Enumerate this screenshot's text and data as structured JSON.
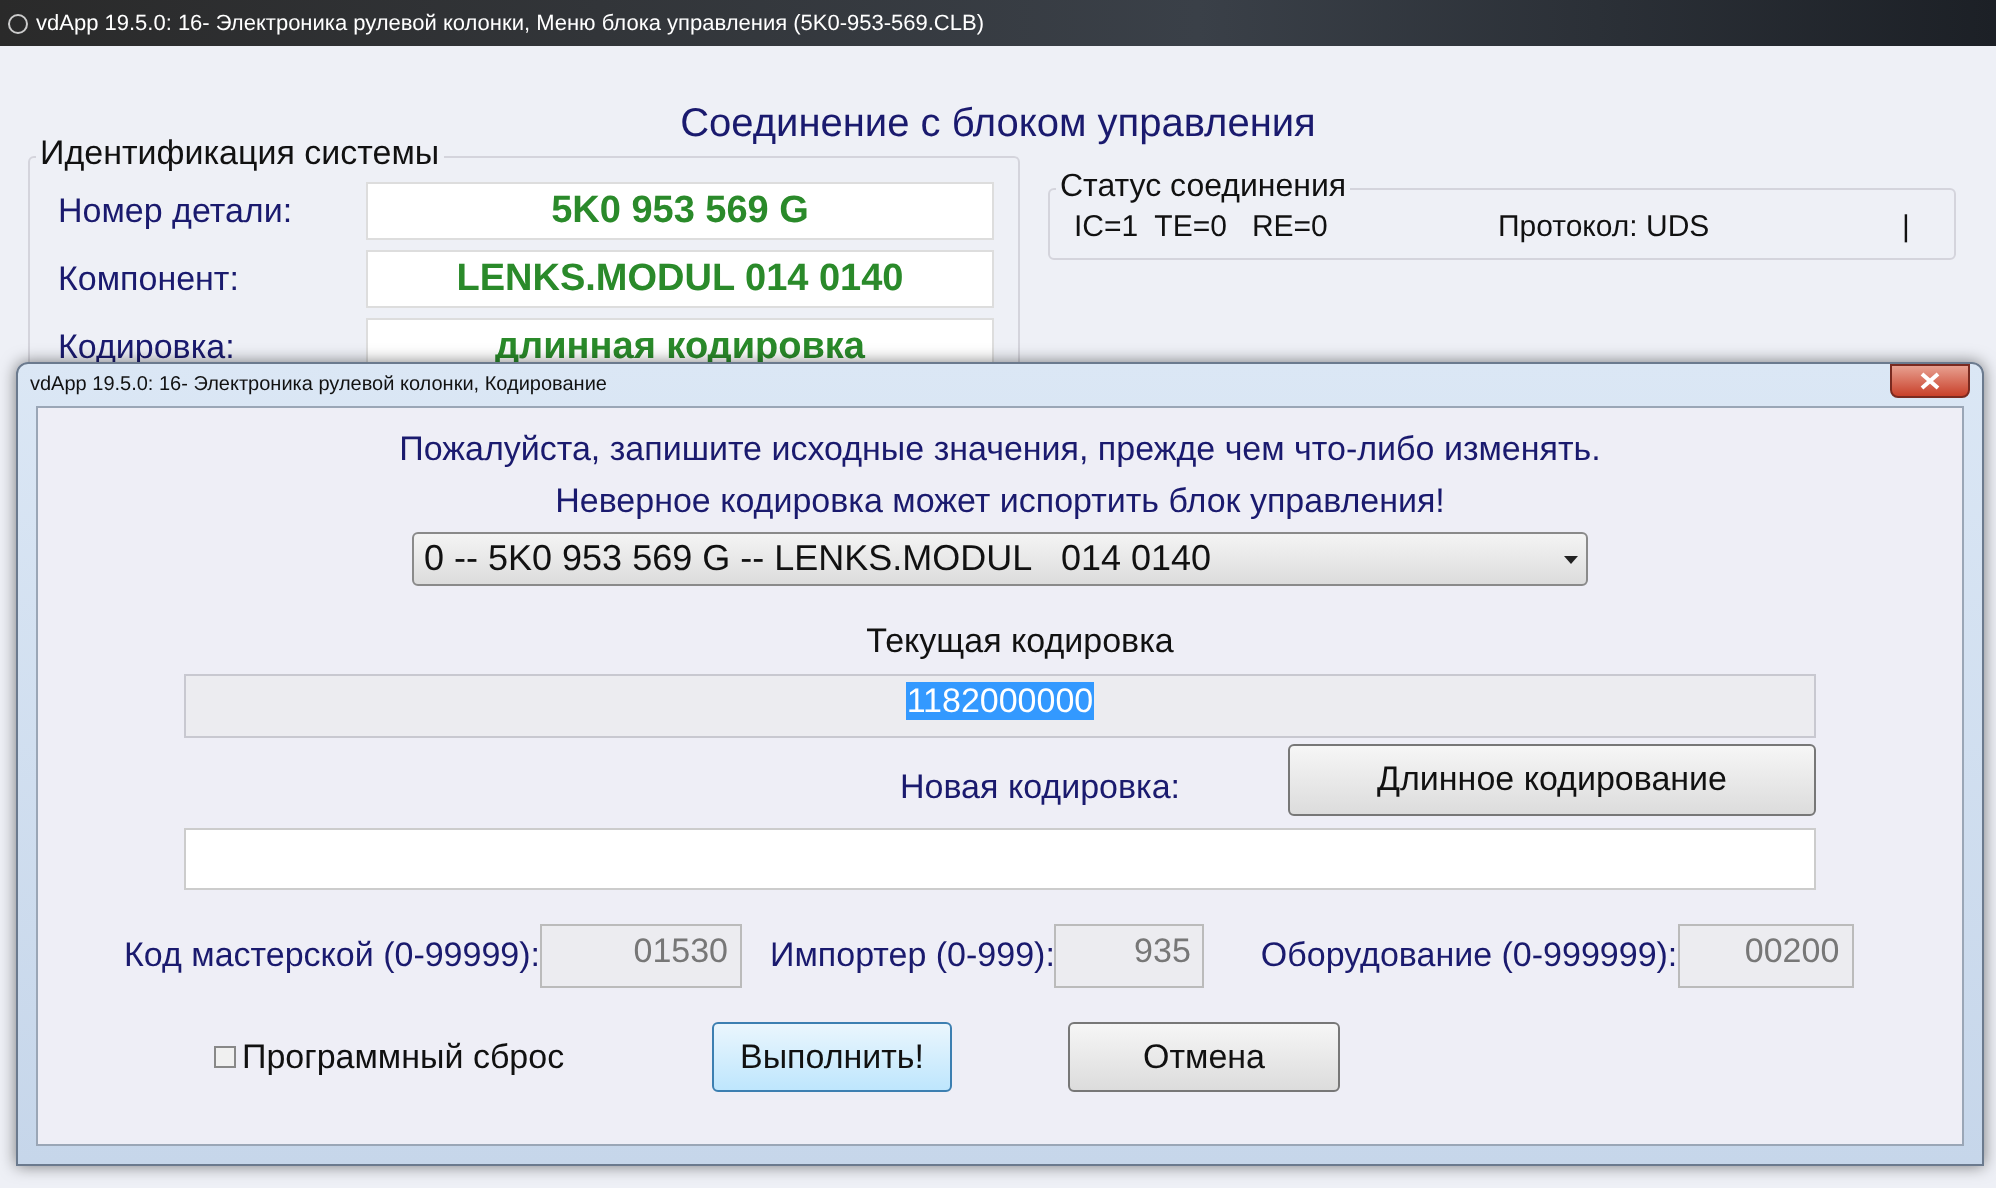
{
  "main_window": {
    "title": "vdApp 19.5.0: 16- Электроника рулевой колонки,  Меню блока управления (5K0-953-569.CLB)",
    "heading": "Соединение с блоком управления",
    "identification": {
      "title": "Идентификация системы",
      "rows": [
        {
          "label": "Номер детали:",
          "value": "5K0 953 569 G"
        },
        {
          "label": "Компонент:",
          "value": "LENKS.MODUL   014 0140"
        },
        {
          "label": "Кодировка:",
          "value": "длинная кодировка"
        }
      ]
    },
    "connection_status": {
      "title": "Статус соединения",
      "values": "IC=1  TE=0   RE=0",
      "protocol": "Протокол: UDS",
      "indicator": "|"
    }
  },
  "dialog": {
    "title": "vdApp 19.5.0: 16- Электроника рулевой колонки,  Кодирование",
    "warning_lines": [
      "Пожалуйста, запишите исходные значения, прежде чем что-либо изменять.",
      "Неверное кодировка может испортить блок управления!"
    ],
    "module_select": {
      "value": "0 -- 5K0 953 569 G -- LENKS.MODUL   014 0140"
    },
    "current_coding": {
      "label": "Текущая кодировка",
      "value": "1182000000",
      "selected": true
    },
    "new_coding": {
      "label": "Новая кодировка:",
      "long_coding_button": "Длинное кодирование"
    },
    "codes": [
      {
        "label": "Код мастерской (0-99999):",
        "value": "01530"
      },
      {
        "label": "Импортер (0-999):",
        "value": "935"
      },
      {
        "label": "Оборудование (0-999999):",
        "value": "00200"
      }
    ],
    "soft_reset": {
      "label": "Программный сброс",
      "checked": false
    },
    "buttons": [
      {
        "label": "Выполнить!",
        "focused": true
      },
      {
        "label": "Отмена",
        "focused": false
      }
    ]
  }
}
